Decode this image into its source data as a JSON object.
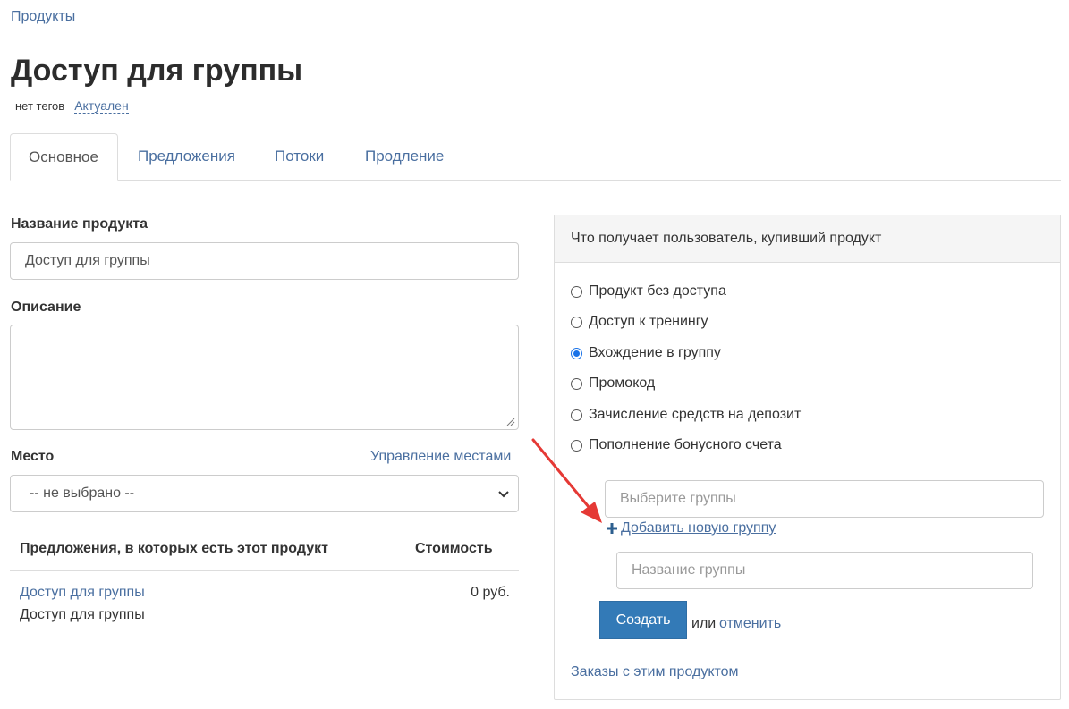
{
  "breadcrumb": {
    "label": "Продукты"
  },
  "page": {
    "title": "Доступ для группы",
    "tags_text": "нет тегов",
    "status_label": "Актуален"
  },
  "tabs": [
    {
      "label": "Основное",
      "active": true
    },
    {
      "label": "Предложения",
      "active": false
    },
    {
      "label": "Потоки",
      "active": false
    },
    {
      "label": "Продление",
      "active": false
    }
  ],
  "form": {
    "name_label": "Название продукта",
    "name_value": "Доступ для группы",
    "description_label": "Описание",
    "description_value": "",
    "place_label": "Место",
    "manage_places_link": "Управление местами",
    "place_selected": "-- не выбрано --"
  },
  "offers": {
    "header_offer": "Предложения, в которых есть этот продукт",
    "header_price": "Стоимость",
    "rows": [
      {
        "link": "Доступ для группы",
        "subtitle": "Доступ для группы",
        "price": "0 руб."
      }
    ]
  },
  "panel": {
    "heading": "Что получает пользователь, купивший продукт",
    "options": [
      {
        "label": "Продукт без доступа",
        "checked": false
      },
      {
        "label": "Доступ к тренингу",
        "checked": false
      },
      {
        "label": "Вхождение в группу",
        "checked": true
      },
      {
        "label": "Промокод",
        "checked": false
      },
      {
        "label": "Зачисление средств на депозит",
        "checked": false
      },
      {
        "label": "Пополнение бонусного счета",
        "checked": false
      }
    ],
    "groups_placeholder": "Выберите группы",
    "add_group_label": "Добавить новую группу",
    "group_name_placeholder": "Название группы",
    "create_button": "Создать",
    "or_text": "или",
    "cancel_link": "отменить",
    "orders_link": "Заказы с этим продуктом"
  },
  "colors": {
    "link": "#4a6fa0",
    "primary_button": "#337ab7",
    "annotation_arrow": "#e53935",
    "radio_checked": "#1a73e8"
  }
}
